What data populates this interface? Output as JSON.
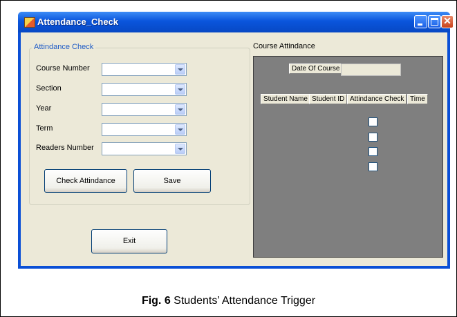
{
  "window": {
    "title": "Attendance_Check",
    "icons": {
      "app": "app-icon",
      "minimize": "minimize-icon",
      "maximize": "maximize-icon",
      "close": "close-icon"
    }
  },
  "form": {
    "group_title": "Attindance Check",
    "fields": [
      {
        "label": "Course Number",
        "value": ""
      },
      {
        "label": "Section",
        "value": ""
      },
      {
        "label": "Year",
        "value": ""
      },
      {
        "label": "Term",
        "value": ""
      },
      {
        "label": "Readers Number",
        "value": ""
      }
    ],
    "check_button": "Check Attindance",
    "save_button": "Save",
    "exit_button": "Exit"
  },
  "attendance_panel": {
    "label": "Course Attindance",
    "date_label": "Date Of Course",
    "date_value": "",
    "columns": [
      "Student Name",
      "Student ID",
      "Attindance Check",
      "Time"
    ],
    "checkbox_count": 4
  },
  "caption": {
    "prefix": "Fig. 6",
    "text": " Students’ Attendance Trigger"
  },
  "colors": {
    "titlebar": "#0a55dc",
    "client": "#ece9d8",
    "panel": "#7f7f7f",
    "group_title": "#1e5bc6"
  }
}
